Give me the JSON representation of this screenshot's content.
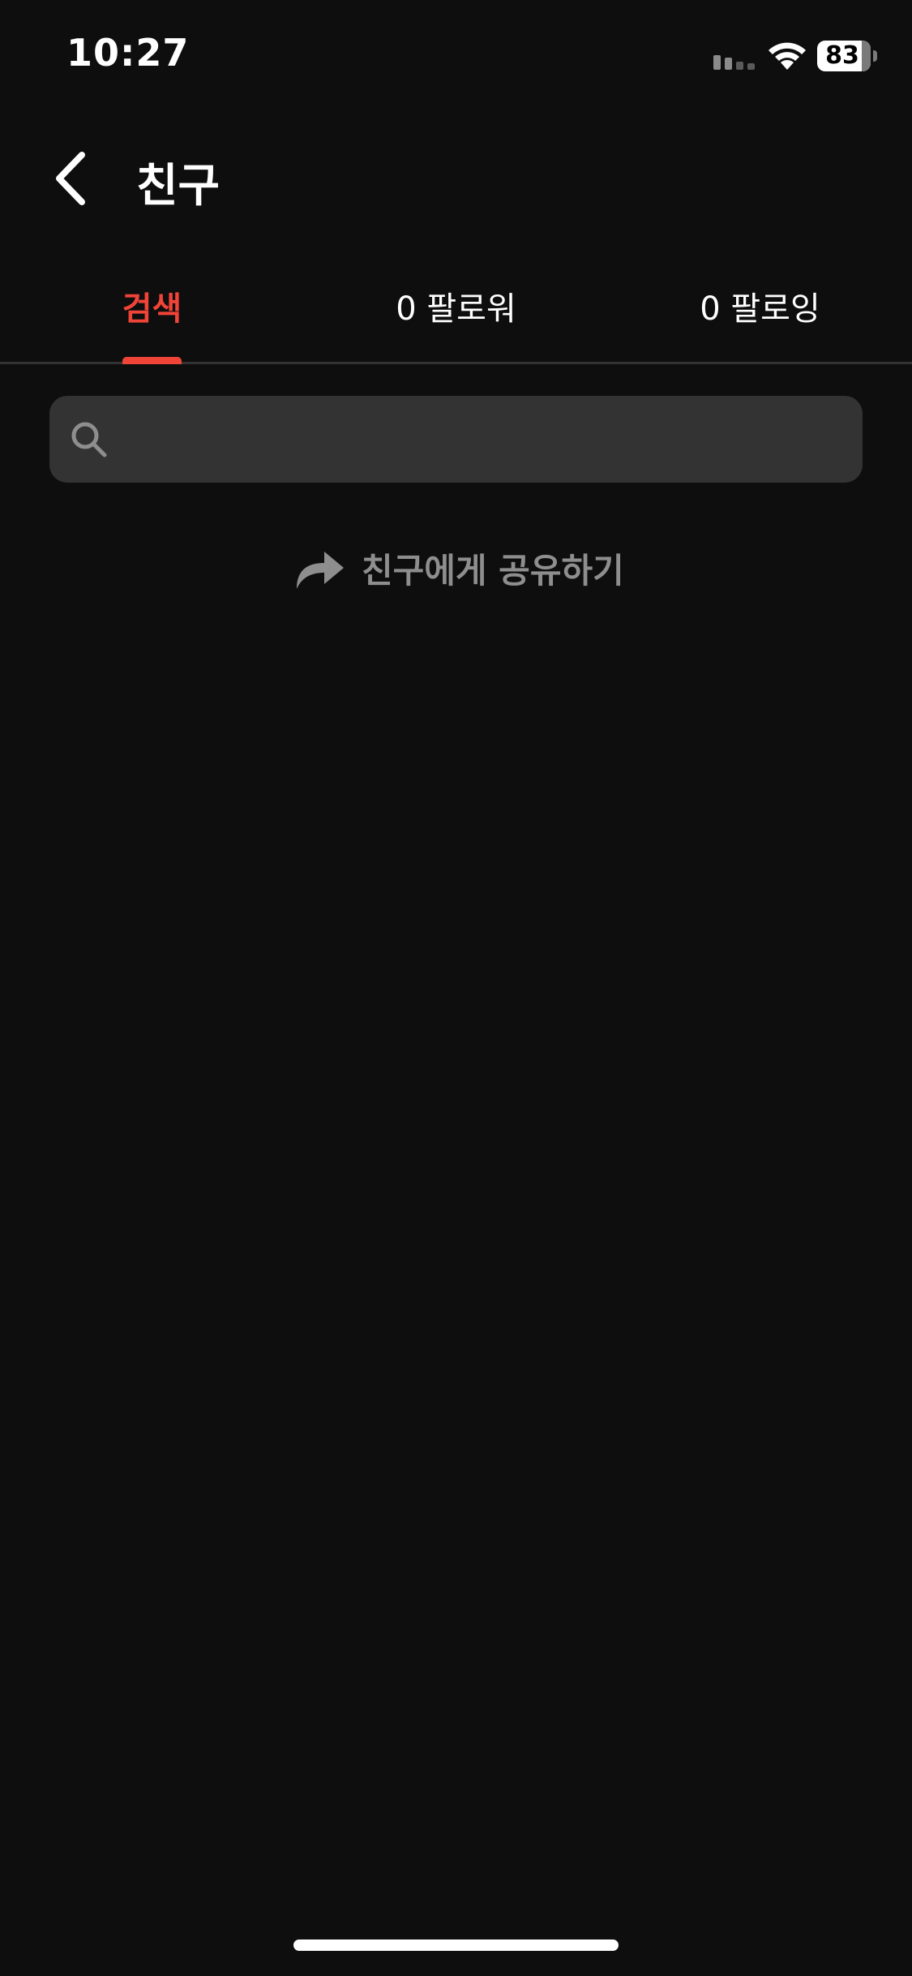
{
  "status_bar": {
    "time": "10:27",
    "battery_level": 83,
    "battery_text": "83"
  },
  "header": {
    "title": "친구"
  },
  "tabs": [
    {
      "label": "검색",
      "active": true
    },
    {
      "label": "0 팔로워",
      "active": false
    },
    {
      "label": "0 팔로잉",
      "active": false
    }
  ],
  "search": {
    "value": "",
    "placeholder": ""
  },
  "share": {
    "label": "친구에게 공유하기"
  },
  "colors": {
    "background": "#0e0e0e",
    "accent": "#f04438",
    "search_bg": "#333333",
    "muted_text": "#8e8e8e"
  },
  "icons": {
    "back": "chevron-left-icon",
    "search": "search-icon",
    "share": "share-arrow-icon",
    "signal": "cellular-signal-icon",
    "wifi": "wifi-icon",
    "battery": "battery-icon"
  }
}
